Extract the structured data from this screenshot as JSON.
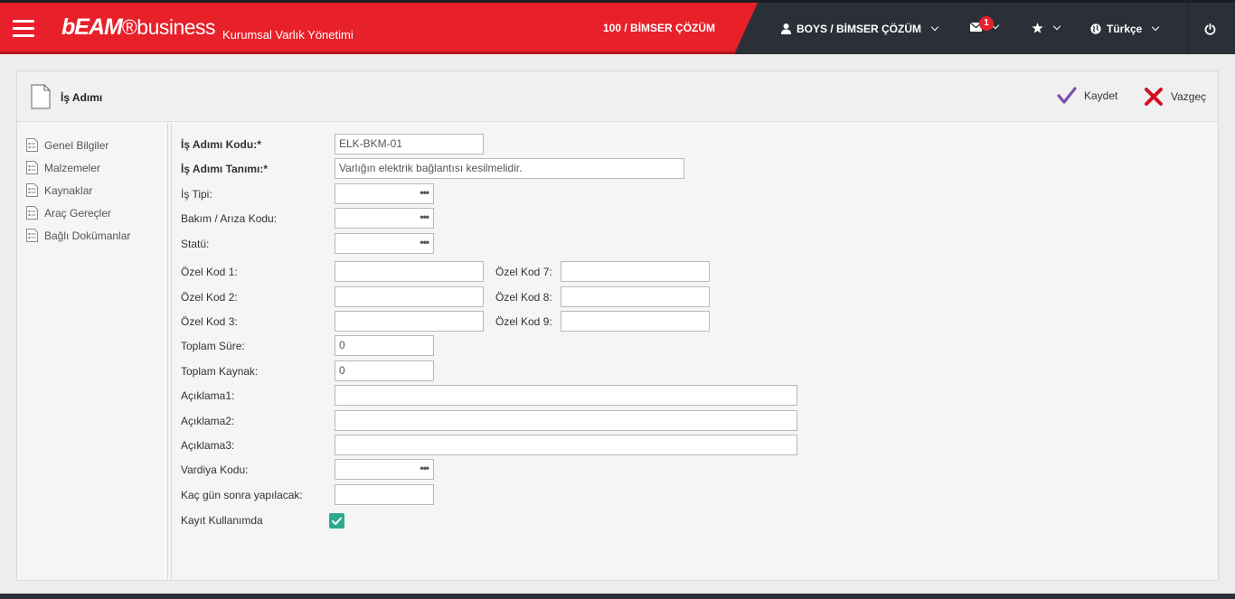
{
  "header": {
    "logo_bold": "bEAM",
    "logo_reg": "®business",
    "subtitle": "Kurumsal Varlık Yönetimi",
    "company": "100 / BİMSER ÇÖZÜM",
    "user": "BOYS / BİMSER ÇÖZÜM",
    "mail_count": "1",
    "language": "Türkçe",
    "icons": [
      "hamburger-icon",
      "user-icon",
      "mail-icon",
      "star-icon",
      "globe-icon",
      "power-icon"
    ]
  },
  "panel": {
    "title": "İş Adımı",
    "save_label": "Kaydet",
    "cancel_label": "Vazgeç"
  },
  "sidebar": {
    "items": [
      {
        "label": "Genel Bilgiler"
      },
      {
        "label": "Malzemeler"
      },
      {
        "label": "Kaynaklar"
      },
      {
        "label": "Araç Gereçler"
      },
      {
        "label": "Bağlı Dokümanlar"
      }
    ]
  },
  "form": {
    "code_label": "İş Adımı Kodu:*",
    "code_value": "ELK-BKM-01",
    "desc_label": "İş Adımı Tanımı:*",
    "desc_value": "Varlığın elektrik bağlantısı kesilmelidir.",
    "type_label": "İş Tipi:",
    "fault_label": "Bakım / Arıza Kodu:",
    "status_label": "Statü:",
    "special1": "Özel Kod 1:",
    "special2": "Özel Kod 2:",
    "special3": "Özel Kod 3:",
    "special7": "Özel Kod 7:",
    "special8": "Özel Kod 8:",
    "special9": "Özel Kod 9:",
    "total_time_label": "Toplam Süre:",
    "total_time_value": "0",
    "total_res_label": "Toplam Kaynak:",
    "total_res_value": "0",
    "note1_label": "Açıklama1:",
    "note2_label": "Açıklama2:",
    "note3_label": "Açıklama3:",
    "shift_label": "Vardiya Kodu:",
    "days_label": "Kaç gün sonra yapılacak:",
    "in_use_label": "Kayıt Kullanımda",
    "in_use_checked": true,
    "lookup_dots": "•••"
  },
  "colors": {
    "brand_red": "#e8202a",
    "dark_nav": "#2b3038",
    "save_check": "#7b4fa8",
    "cancel_x": "#d01020",
    "checkbox": "#2bab8e"
  }
}
